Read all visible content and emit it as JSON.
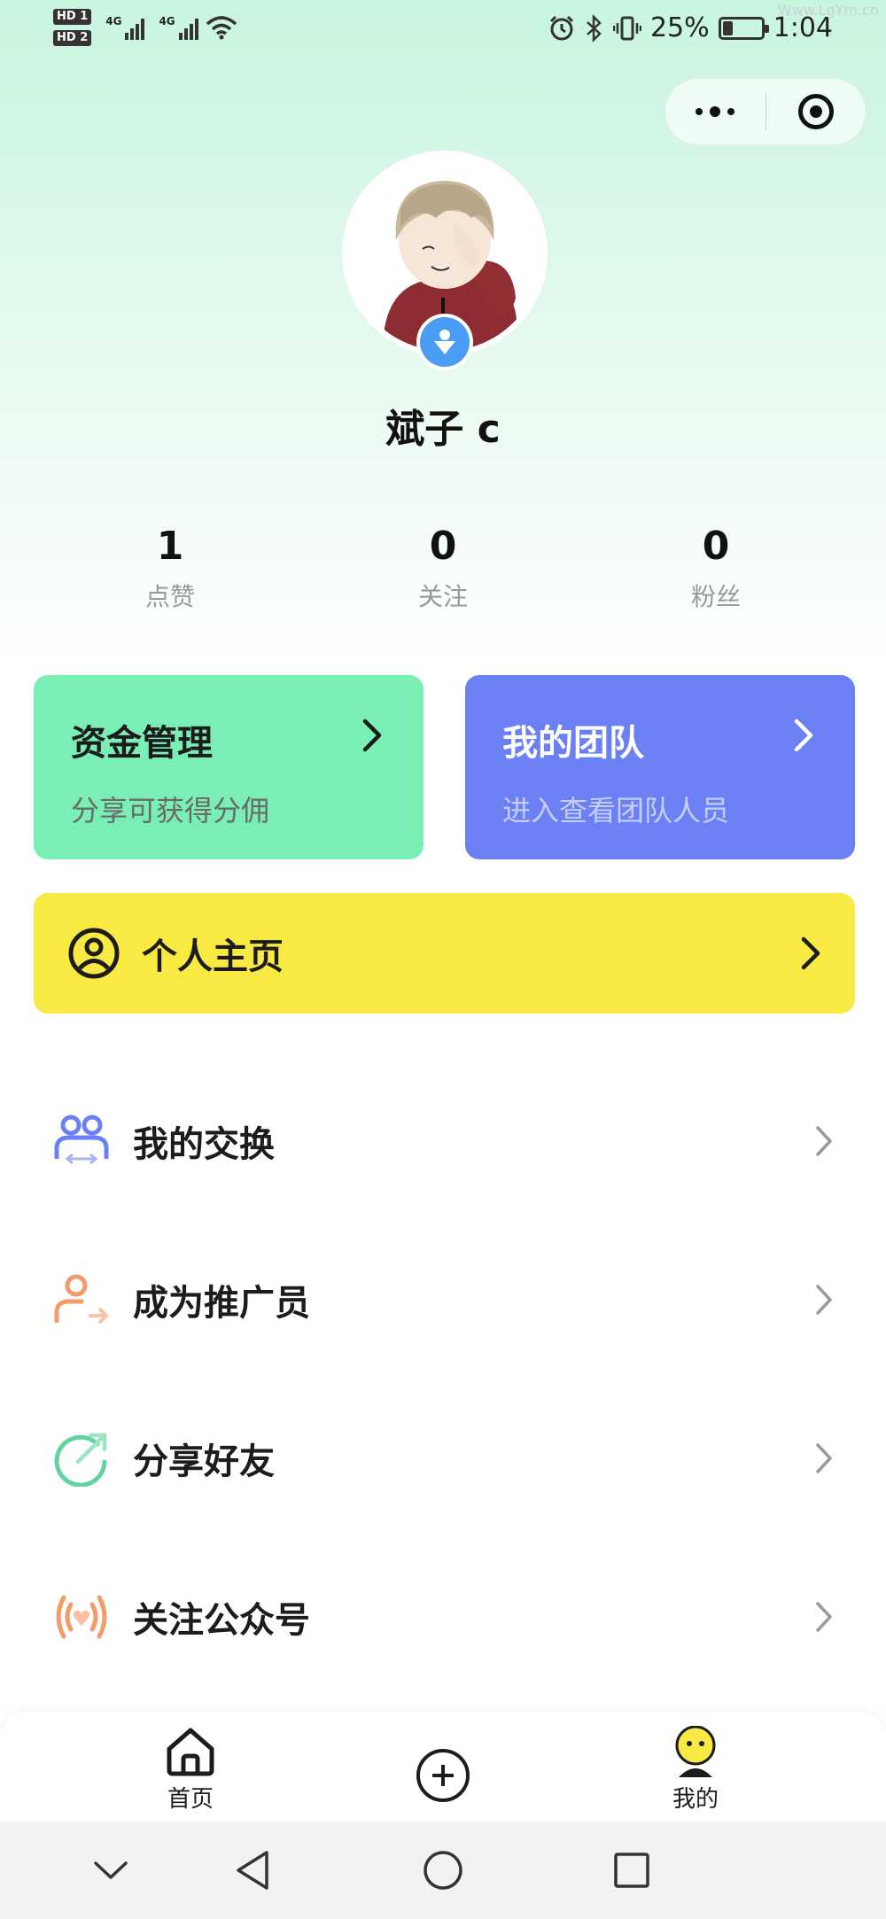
{
  "status_bar": {
    "hd1": "HD 1",
    "hd2": "HD 2",
    "net1": "4G",
    "net2": "4G",
    "battery_pct": "25%",
    "time": "1:04",
    "battery_level": 0.25
  },
  "watermark": "Www.LgYm.cn",
  "profile": {
    "username": "斌子 c",
    "stats": [
      {
        "value": "1",
        "label": "点赞"
      },
      {
        "value": "0",
        "label": "关注"
      },
      {
        "value": "0",
        "label": "粉丝"
      }
    ]
  },
  "cards": {
    "funds": {
      "title": "资金管理",
      "subtitle": "分享可获得分佣",
      "color": "#7aefb5"
    },
    "team": {
      "title": "我的团队",
      "subtitle": "进入查看团队人员",
      "color": "#6b80f3"
    }
  },
  "homepage": {
    "label": "个人主页",
    "color": "#f8ea43"
  },
  "menu": [
    {
      "label": "我的交换",
      "icon": "exchange-users-icon"
    },
    {
      "label": "成为推广员",
      "icon": "promoter-icon"
    },
    {
      "label": "分享好友",
      "icon": "share-arrow-icon"
    },
    {
      "label": "关注公众号",
      "icon": "broadcast-heart-icon"
    }
  ],
  "tabbar": {
    "home": "首页",
    "add": "",
    "mine": "我的"
  }
}
